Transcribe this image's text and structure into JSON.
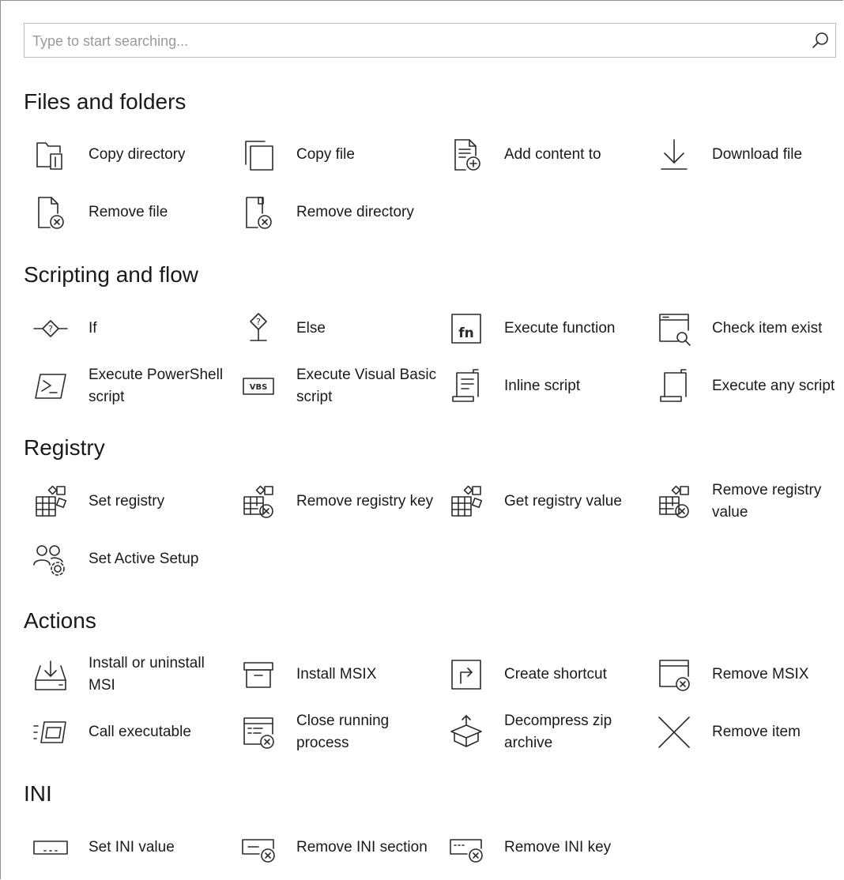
{
  "search": {
    "placeholder": "Type to start searching...",
    "icon": "search-icon"
  },
  "sections": [
    {
      "title": "Files and folders",
      "items": [
        {
          "label": "Copy directory",
          "icon": "copy-directory-icon"
        },
        {
          "label": "Copy file",
          "icon": "copy-file-icon"
        },
        {
          "label": "Add content to",
          "icon": "add-content-icon"
        },
        {
          "label": "Download file",
          "icon": "download-icon"
        },
        {
          "label": "Remove file",
          "icon": "remove-file-icon"
        },
        {
          "label": "Remove directory",
          "icon": "remove-directory-icon"
        }
      ]
    },
    {
      "title": "Scripting and flow",
      "items": [
        {
          "label": "If",
          "icon": "if-icon"
        },
        {
          "label": "Else",
          "icon": "else-icon"
        },
        {
          "label": "Execute function",
          "icon": "function-icon"
        },
        {
          "label": "Check item exist",
          "icon": "check-item-icon"
        },
        {
          "label": "Execute PowerShell script",
          "icon": "powershell-icon"
        },
        {
          "label": "Execute Visual Basic script",
          "icon": "vbs-icon"
        },
        {
          "label": "Inline script",
          "icon": "inline-script-icon"
        },
        {
          "label": "Execute any script",
          "icon": "script-icon"
        }
      ]
    },
    {
      "title": "Registry",
      "items": [
        {
          "label": "Set registry",
          "icon": "registry-icon"
        },
        {
          "label": "Remove registry key",
          "icon": "remove-registry-icon"
        },
        {
          "label": "Get registry value",
          "icon": "registry-icon"
        },
        {
          "label": "Remove registry value",
          "icon": "remove-registry-icon"
        },
        {
          "label": "Set Active Setup",
          "icon": "users-gear-icon"
        }
      ]
    },
    {
      "title": "Actions",
      "items": [
        {
          "label": "Install or uninstall MSI",
          "icon": "install-tray-icon"
        },
        {
          "label": "Install MSIX",
          "icon": "box-icon"
        },
        {
          "label": "Create shortcut",
          "icon": "shortcut-icon"
        },
        {
          "label": "Remove MSIX",
          "icon": "remove-window-icon"
        },
        {
          "label": "Call executable",
          "icon": "executable-icon"
        },
        {
          "label": "Close running process",
          "icon": "close-process-icon"
        },
        {
          "label": "Decompress zip archive",
          "icon": "decompress-icon"
        },
        {
          "label": "Remove item",
          "icon": "remove-item-icon"
        }
      ]
    },
    {
      "title": "INI",
      "items": [
        {
          "label": "Set INI value",
          "icon": "ini-value-icon"
        },
        {
          "label": "Remove INI section",
          "icon": "remove-ini-section-icon"
        },
        {
          "label": "Remove INI key",
          "icon": "remove-ini-key-icon"
        }
      ]
    }
  ]
}
